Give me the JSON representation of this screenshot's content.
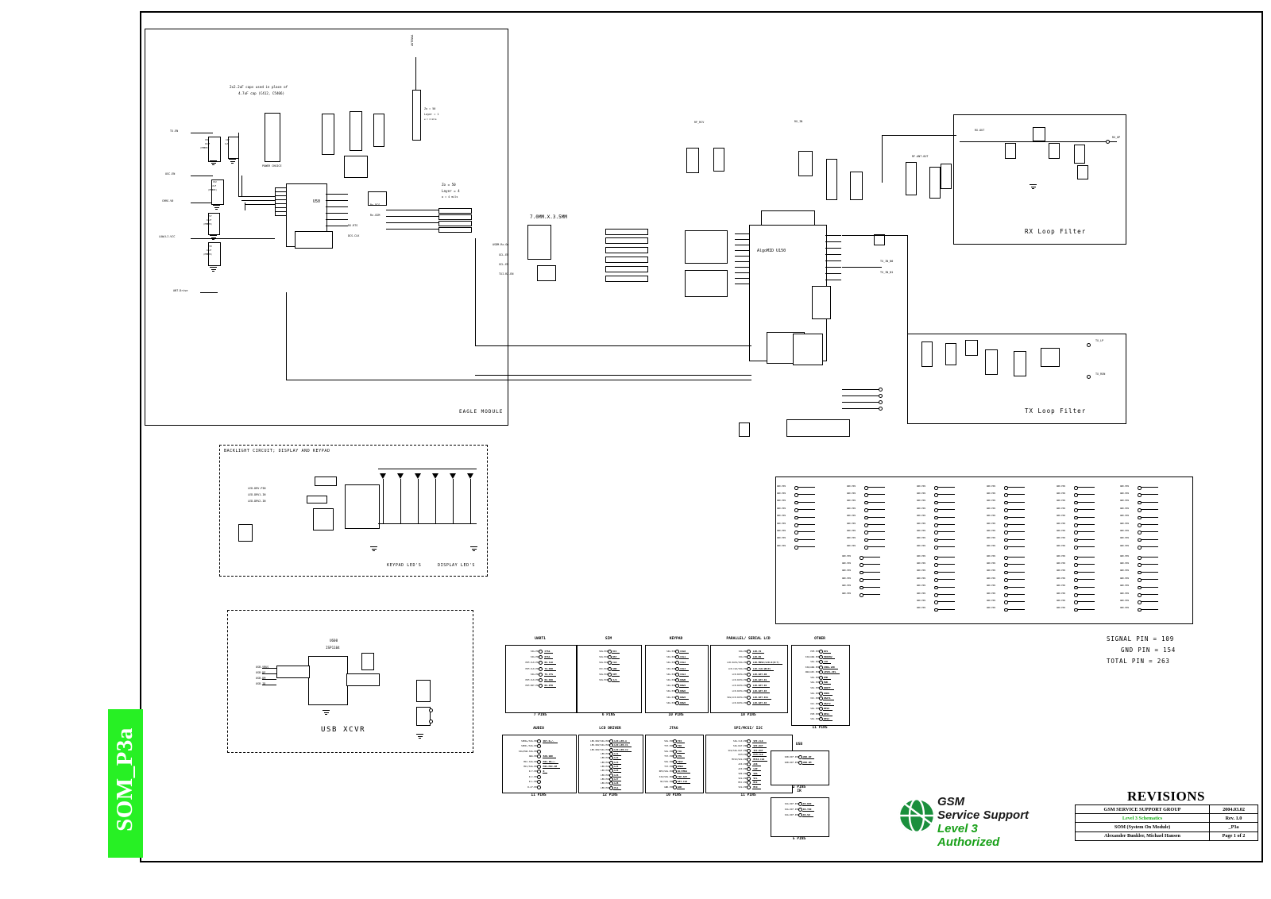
{
  "sheet": {
    "tab_label": "SOM_P3a",
    "tab_color": "#27f024"
  },
  "blocks": {
    "eagle_module": "EAGLE MODULE",
    "rx_loop_filter": "RX Loop Filter",
    "tx_loop_filter": "TX Loop Filter",
    "backlight": "BACKLIGHT CIRCUIT; DISPLAY AND KEYPAD",
    "keypad_leds": "KEYPAD LED'S",
    "display_leds": "DISPLAY LED'S",
    "usb_xcvr": "USB  XCVR"
  },
  "notes": {
    "caps_note_l1": "2x2.2uF caps used in place of",
    "caps_note_l2": "4.7uF cap (C412, C5406)",
    "antenna": "ANTENNA",
    "z0_top_l1": "Zo = 50",
    "z0_top_l2": "Layer = 1",
    "z0_top_l3": "w = 4 mils",
    "z0_mid_l1": "Zo = 50",
    "z0_mid_l2": "Layer = 4",
    "z0_mid_l3": "w = 4 mils",
    "board_dims": "7.0MM.X.3.5MM",
    "power_choice": "POWER CHOICE",
    "u50": "U50",
    "u150": "U150",
    "algomid": "AlgoMID  U150",
    "u600": "U600",
    "u600_pn": "ISP1104"
  },
  "pin_summary": {
    "signal": "SIGNAL PIN = 109",
    "gnd": "GND PIN = 154",
    "total": "TOTAL PIN = 263"
  },
  "logo": {
    "line1": "GSM",
    "line2": "Service Support",
    "line3": "Level 3 Authorized"
  },
  "revisions": {
    "title": "REVISIONS",
    "rows": [
      {
        "left": "GSM SERVICE SUPPORT GROUP",
        "right": "2004.03.02",
        "green": false
      },
      {
        "left": "Level 3 Schematics",
        "right": "Rev. 1.0",
        "green": true
      },
      {
        "left": "SOM (System On Module)",
        "right": "_P3a",
        "green": false
      },
      {
        "left": "Alexander Bunkler, Michael Hansen",
        "right": "Page 1 of 2",
        "green": false
      }
    ]
  },
  "connector_groups": [
    {
      "name": "UART1",
      "count": "7 PINS",
      "pins": [
        {
          "left": "SIG.PIN",
          "right": "CTS1"
        },
        {
          "left": "SIG.PIN",
          "right": "RTS1"
        },
        {
          "left": "PCM.CLK.PIN",
          "right": "RX.CLK"
        },
        {
          "left": "PCM.CLK.PIN",
          "right": "TX.DIR"
        },
        {
          "left": "SIG.PIN",
          "right": "TX.CTS"
        },
        {
          "left": "PCM.CLK.PIN",
          "right": "RX.DIR"
        },
        {
          "left": "PCM.BIT.PIN",
          "right": "RX.DTR"
        }
      ]
    },
    {
      "name": "SIM",
      "count": "6 PINS",
      "pins": [
        {
          "left": "SIG.PIN",
          "right": "VCC"
        },
        {
          "left": "SIG.PIN",
          "right": "RST"
        },
        {
          "left": "SIG.PIN",
          "right": "CLK"
        },
        {
          "left": "VCC.PIN",
          "right": "GND"
        },
        {
          "left": "SIG.PIN",
          "right": "VPP"
        },
        {
          "left": "SIG.PIN",
          "right": "I/O"
        }
      ]
    },
    {
      "name": "KEYPAD",
      "count": "10 PINS",
      "pins": [
        {
          "left": "SIG.PIN",
          "right": "COL0"
        },
        {
          "left": "SIG.PIN",
          "right": "COL1"
        },
        {
          "left": "SIG.PIN",
          "right": "COL2"
        },
        {
          "left": "SIG.PIN",
          "right": "COL3"
        },
        {
          "left": "SIG.PIN",
          "right": "COL4"
        },
        {
          "left": "SIG.PIN",
          "right": "ROW0"
        },
        {
          "left": "SIG.PIN",
          "right": "ROW1"
        },
        {
          "left": "SIG.PIN",
          "right": "ROW2"
        },
        {
          "left": "SIG.PIN",
          "right": "ROW3"
        },
        {
          "left": "SIG.PIN",
          "right": "ROW4"
        }
      ]
    },
    {
      "name": "PARALLEL/ SERIAL LCD",
      "count": "10 PINS",
      "pins": [
        {
          "left": "SIG.PIN",
          "right": "LCD.CS"
        },
        {
          "left": "SIG.PIN",
          "right": "LCD.RS"
        },
        {
          "left": "LCD.DATA/SIG.PIN",
          "right": "LCD.MOSI/LCD.D(0:7)"
        },
        {
          "left": "LCD.CLK/SIG.PIN",
          "right": "LCD.CLK.WR(E)"
        },
        {
          "left": "LCD.DATA.PIN",
          "right": "LCD.DAT.D0"
        },
        {
          "left": "LCD.DATA.PIN",
          "right": "LCD.DAT.D1"
        },
        {
          "left": "LCD.DATA.PIN",
          "right": "LCD.DAT.D2"
        },
        {
          "left": "LCD.DATA.PIN",
          "right": "LCD.DAT.D3"
        },
        {
          "left": "SIG/LCD.DATA.PIN",
          "right": "LCD.DAT.D11"
        },
        {
          "left": "LCD.DATA.PIN",
          "right": "LCD.DAT.D4"
        }
      ]
    },
    {
      "name": "OTHER",
      "count": "11 PINS",
      "pins": [
        {
          "left": "PCM.PIN",
          "right": "RCS"
        },
        {
          "left": "SIG/ANA.PIN",
          "right": "HOOKSW"
        },
        {
          "left": "SIG.PIN",
          "right": "LCD"
        },
        {
          "left": "SIG/ANA.PIN",
          "right": "CHRG.LED"
        },
        {
          "left": "ANA/ADC.PIN",
          "right": "LEVEL.SEL"
        },
        {
          "left": "SIG.PIN",
          "right": "IMD"
        },
        {
          "left": "SIG.PIN",
          "right": "PWR"
        },
        {
          "left": "SIG.PIN",
          "right": "ONOFF"
        },
        {
          "left": "SIG.PIN",
          "right": "SHDN"
        },
        {
          "left": "VCC.PIN",
          "right": "VBAT1"
        },
        {
          "left": "VCC.PIN",
          "right": "VBAT2"
        },
        {
          "left": "SIG.PIN",
          "right": "RES0"
        },
        {
          "left": "PCM.PIN",
          "right": "RES1"
        },
        {
          "left": "SIG.PIN",
          "right": "RES2"
        }
      ]
    },
    {
      "name": "AUDIO",
      "count": "11 PINS",
      "pins": [
        {
          "left": "SPKR+/SIG.PIN",
          "right": "OUT.R+/-"
        },
        {
          "left": "SPKR-/SIG.PIN",
          "right": ""
        },
        {
          "left": "SIG/EAR.SIG.PIN",
          "right": ""
        },
        {
          "left": "ANA.PIN",
          "right": "EAR.GND"
        },
        {
          "left": "MIC.SIG.PIN",
          "right": "MIC.IN+/-"
        },
        {
          "left": "MIC/SIG.PIN",
          "right": "MIC.MIC.AM"
        },
        {
          "left": "R-T.PIN",
          "right": "R"
        },
        {
          "left": "R-C.PIN",
          "right": ""
        },
        {
          "left": "R-L.PIN",
          "right": ""
        },
        {
          "left": "R-LF.PIN",
          "right": ""
        }
      ]
    },
    {
      "name": "LCD DRIVER",
      "count": "12 PINS",
      "pins": [
        {
          "left": "LED.DRV/SIG.PIN",
          "right": "LCD.LED.A"
        },
        {
          "left": "LED.DRV/SIG.PIN",
          "right": "LCD.LED.C1"
        },
        {
          "left": "LED.DRV/SIG.PIN",
          "right": "LCD.LED.C2"
        },
        {
          "left": "LED.PIN",
          "right": "LC1"
        },
        {
          "left": "LED.PIN",
          "right": "LC2"
        },
        {
          "left": "LED.PIN",
          "right": "LC3"
        },
        {
          "left": "LED.PIN",
          "right": "LC4"
        },
        {
          "left": "LED.PIN",
          "right": "LC5"
        },
        {
          "left": "LED.PIN",
          "right": "LC6"
        },
        {
          "left": "LED.PIN",
          "right": "LC7"
        },
        {
          "left": "LED.PIN",
          "right": "LC8"
        },
        {
          "left": "LED.PIN",
          "right": "PL1"
        }
      ]
    },
    {
      "name": "JTAG",
      "count": "10 PINS",
      "pins": [
        {
          "left": "SIG.PIN",
          "right": "TDI"
        },
        {
          "left": "TST.PIN",
          "right": "TDO"
        },
        {
          "left": "SIG.PIN",
          "right": "TCK"
        },
        {
          "left": "TST.PIN",
          "right": "TMS"
        },
        {
          "left": "SIG.PIN",
          "right": "TRST"
        },
        {
          "left": "TST.PIN",
          "right": "EMU0"
        },
        {
          "left": "RES/SIG.PIN",
          "right": "NC/EMU1"
        },
        {
          "left": "SIG/SIG.PIN",
          "right": "TXP.SET"
        },
        {
          "left": "NC/SIG.PIN",
          "right": "SET.CLK"
        },
        {
          "left": "GND.PIN",
          "right": "GND"
        }
      ]
    },
    {
      "name": "SPI/MCSI/ I2C",
      "count": "11 PINS",
      "pins": [
        {
          "left": "SIG.CLK.PIN",
          "right": "SPI.CLK"
        },
        {
          "left": "SIG.DAT.PIN",
          "right": "SPI.DAT"
        },
        {
          "left": "SIG/SIG.DAT.PIN",
          "right": "I2C.DAT"
        },
        {
          "left": "PCM.PIN",
          "right": "PCM.CLK"
        },
        {
          "left": "MCSI/SIG.PIN",
          "right": "MCSI.CLK"
        },
        {
          "left": "ACK.PIN",
          "right": "ACK"
        },
        {
          "left": "ACK.PIN",
          "right": "LDP"
        },
        {
          "left": "SPK.PIN",
          "right": "SDA"
        },
        {
          "left": "SIG.PIN",
          "right": "SCL"
        },
        {
          "left": "MIC.PIN",
          "right": "MCI"
        },
        {
          "left": "SIG.PIN",
          "right": "MCO"
        }
      ]
    },
    {
      "name": "USB",
      "count": "2 PINS",
      "pins": [
        {
          "left": "USB.DIF.PIN",
          "right": "USB.DP"
        },
        {
          "left": "USB.DIF.PIN",
          "right": "USB.DM"
        }
      ]
    },
    {
      "name": "IR",
      "count": "5 PINS",
      "pins": [
        {
          "left": "SIG.DIF.PIN",
          "right": "IR.RXD"
        },
        {
          "left": "SIG.DIF.PIN",
          "right": "IR.TXD"
        },
        {
          "left": "SIG.DIF.PIN",
          "right": "IR.SD"
        }
      ]
    }
  ],
  "left_signals": [
    "TX.EN",
    "OSC.EN",
    "CHRG.V0",
    "LOW/LI.VCC",
    "ANT.Drive"
  ],
  "eagle_signals_right": [
    "Rx.DCS",
    "Rx.GSM",
    "RX.RTS",
    "DCS.CLK"
  ],
  "eagle_mid_signals": [
    "ASDM.Rx.On",
    "GCL.EN",
    "GCL.EN",
    "TXI.RX.EN"
  ],
  "rf_labels": {
    "rf_rcv": "RF_RCV",
    "rx_in": "RX_IN",
    "rf_ant_out": "RF.ANT.OUT",
    "rx_out": "RX.OUT",
    "rx_op": "RX_OP",
    "tx_lp": "TX_LP",
    "tx_rxn": "TX_RXN",
    "tx_in_n0": "TX_IN_N0",
    "tx_in_n1": "TX_IN_N1"
  }
}
